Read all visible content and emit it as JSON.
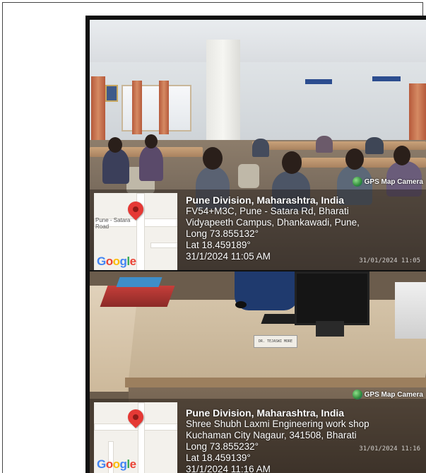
{
  "photos": [
    {
      "scene": "classroom",
      "brand": "GPS Map Camera",
      "map": {
        "label_line1": "Pune - Satara",
        "label_line2": "Road",
        "google": "Google"
      },
      "info": {
        "title": "Pune Division, Maharashtra, India",
        "address_line1": "FV54+M3C, Pune - Satara Rd, Bharati",
        "address_line2": "Vidyapeeth Campus, Dhankawadi, Pune,",
        "long": "Long 73.855132°",
        "lat": "Lat 18.459189°",
        "datetime": "31/1/2024 11:05 AM"
      },
      "watermark_time": "31/01/2024 11:05"
    },
    {
      "scene": "office",
      "brand": "GPS Map Camera",
      "map": {
        "label_line1": "",
        "label_line2": "",
        "google": "Google"
      },
      "info": {
        "title": "Pune Division, Maharashtra, India",
        "address_line1": "Shree Shubh Laxmi Engineering work shop",
        "address_line2": "Kuchaman City Nagaur, 341508, Bharati",
        "long": "Long 73.855232°",
        "lat": "Lat 18.459139°",
        "datetime": "31/1/2024 11:16 AM"
      },
      "watermark_time": "31/01/2024 11:16"
    }
  ],
  "nameplate": "DR. TEJASWI MORE"
}
